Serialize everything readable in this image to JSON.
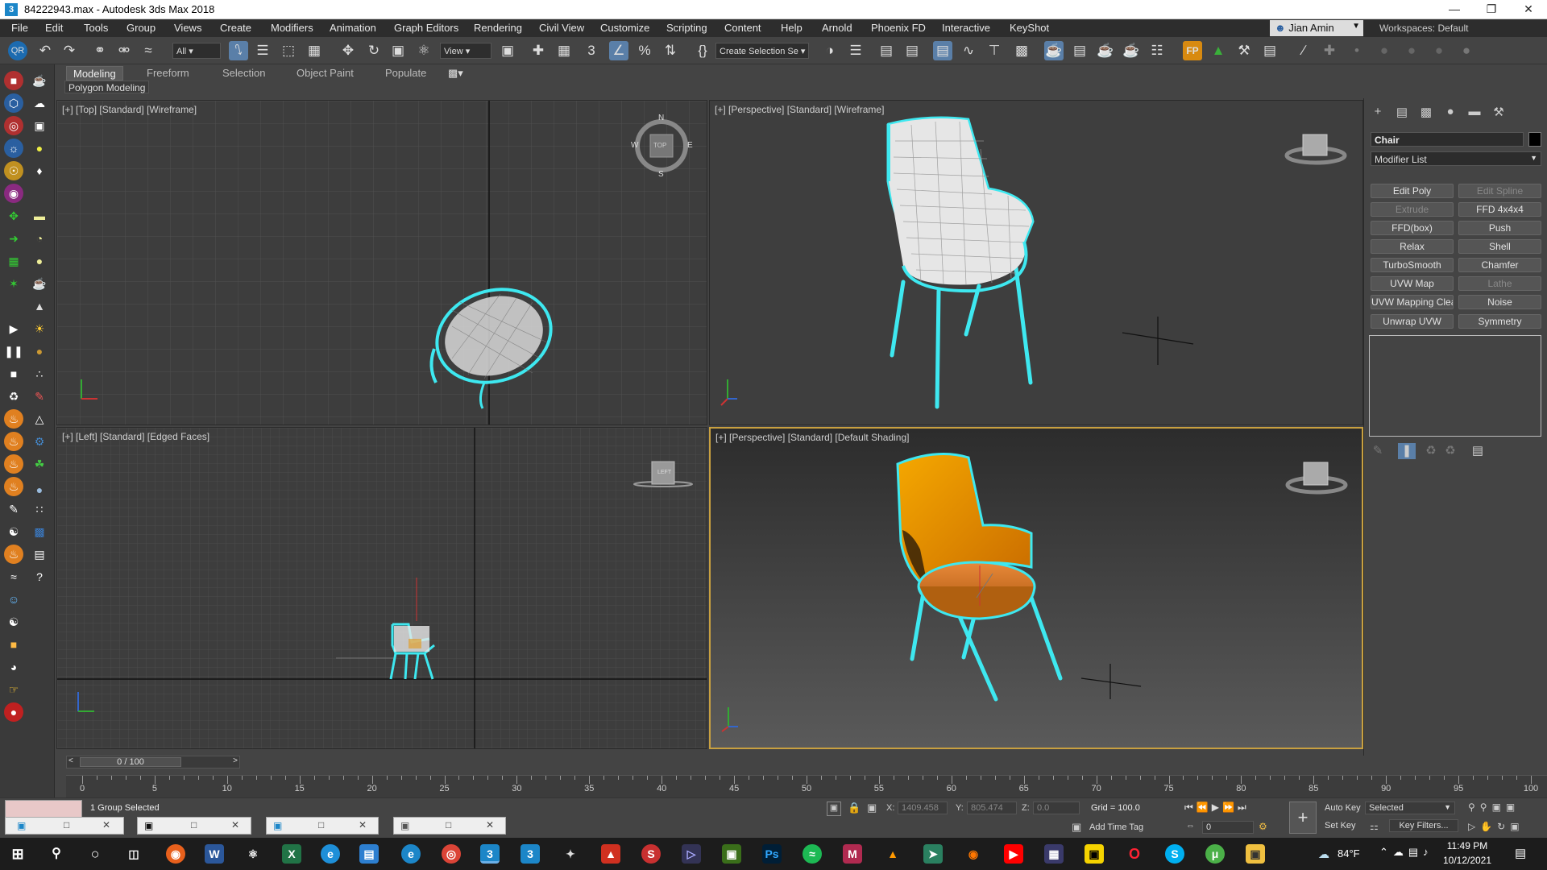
{
  "window": {
    "title": "84222943.max - Autodesk 3ds Max 2018",
    "app_icon": "3",
    "minimize": "—",
    "maximize": "❐",
    "close": "✕"
  },
  "menu": [
    "File",
    "Edit",
    "Tools",
    "Group",
    "Views",
    "Create",
    "Modifiers",
    "Animation",
    "Graph Editors",
    "Rendering",
    "Civil View",
    "Customize",
    "Scripting",
    "Content",
    "Help",
    "Arnold",
    "Phoenix FD",
    "Interactive",
    "KeyShot"
  ],
  "user": {
    "name": "Jian Amin",
    "workspaces_label": "Workspaces:",
    "workspace": "Default"
  },
  "toolbar": {
    "filter": "All",
    "ref_coord": "View",
    "selection_set": "Create Selection Se"
  },
  "ribbon": {
    "tabs": [
      "Modeling",
      "Freeform",
      "Selection",
      "Object Paint",
      "Populate"
    ],
    "active": "Modeling",
    "sub": "Polygon Modeling"
  },
  "viewports": {
    "top": {
      "label": "[+] [Top] [Standard] [Wireframe]",
      "compass": {
        "n": "N",
        "s": "S",
        "e": "E",
        "w": "W",
        "cube": "TOP"
      }
    },
    "persp1": {
      "label": "[+] [Perspective] [Standard] [Wireframe]"
    },
    "left": {
      "label": "[+] [Left] [Standard] [Edged Faces]",
      "cube": "LEFT"
    },
    "persp2": {
      "label": "[+] [Perspective] [Standard] [Default Shading]"
    }
  },
  "command_panel": {
    "object_name": "Chair",
    "modifier_list": "Modifier List",
    "buttons": [
      {
        "label": "Edit Poly",
        "enabled": true
      },
      {
        "label": "Edit Spline",
        "enabled": false
      },
      {
        "label": "Extrude",
        "enabled": false
      },
      {
        "label": "FFD 4x4x4",
        "enabled": true
      },
      {
        "label": "FFD(box)",
        "enabled": true
      },
      {
        "label": "Push",
        "enabled": true
      },
      {
        "label": "Relax",
        "enabled": true
      },
      {
        "label": "Shell",
        "enabled": true
      },
      {
        "label": "TurboSmooth",
        "enabled": true
      },
      {
        "label": "Chamfer",
        "enabled": true
      },
      {
        "label": "UVW Map",
        "enabled": true
      },
      {
        "label": "Lathe",
        "enabled": false
      },
      {
        "label": "UVW Mapping Clear",
        "enabled": true
      },
      {
        "label": "Noise",
        "enabled": true
      },
      {
        "label": "Unwrap UVW",
        "enabled": true
      },
      {
        "label": "Symmetry",
        "enabled": true
      }
    ]
  },
  "timeline": {
    "frame": "0 / 100",
    "ticks": [
      "0",
      "5",
      "10",
      "15",
      "20",
      "25",
      "30",
      "35",
      "40",
      "45",
      "50",
      "55",
      "60",
      "65",
      "70",
      "75",
      "80",
      "85",
      "90",
      "95",
      "100"
    ]
  },
  "status": {
    "selection": "1 Group Selected",
    "x_label": "X:",
    "x": "1409.458",
    "y_label": "Y:",
    "y": "805.474",
    "z_label": "Z:",
    "z": "0.0",
    "grid": "Grid = 100.0",
    "add_time_tag": "Add Time Tag",
    "auto_key": "Auto Key",
    "set_key": "Set Key",
    "key_mode": "Selected",
    "key_filters": "Key Filters...",
    "frame_input": "0"
  },
  "taskbar": {
    "weather": "84°F",
    "time": "11:49 PM",
    "date": "10/12/2021"
  }
}
